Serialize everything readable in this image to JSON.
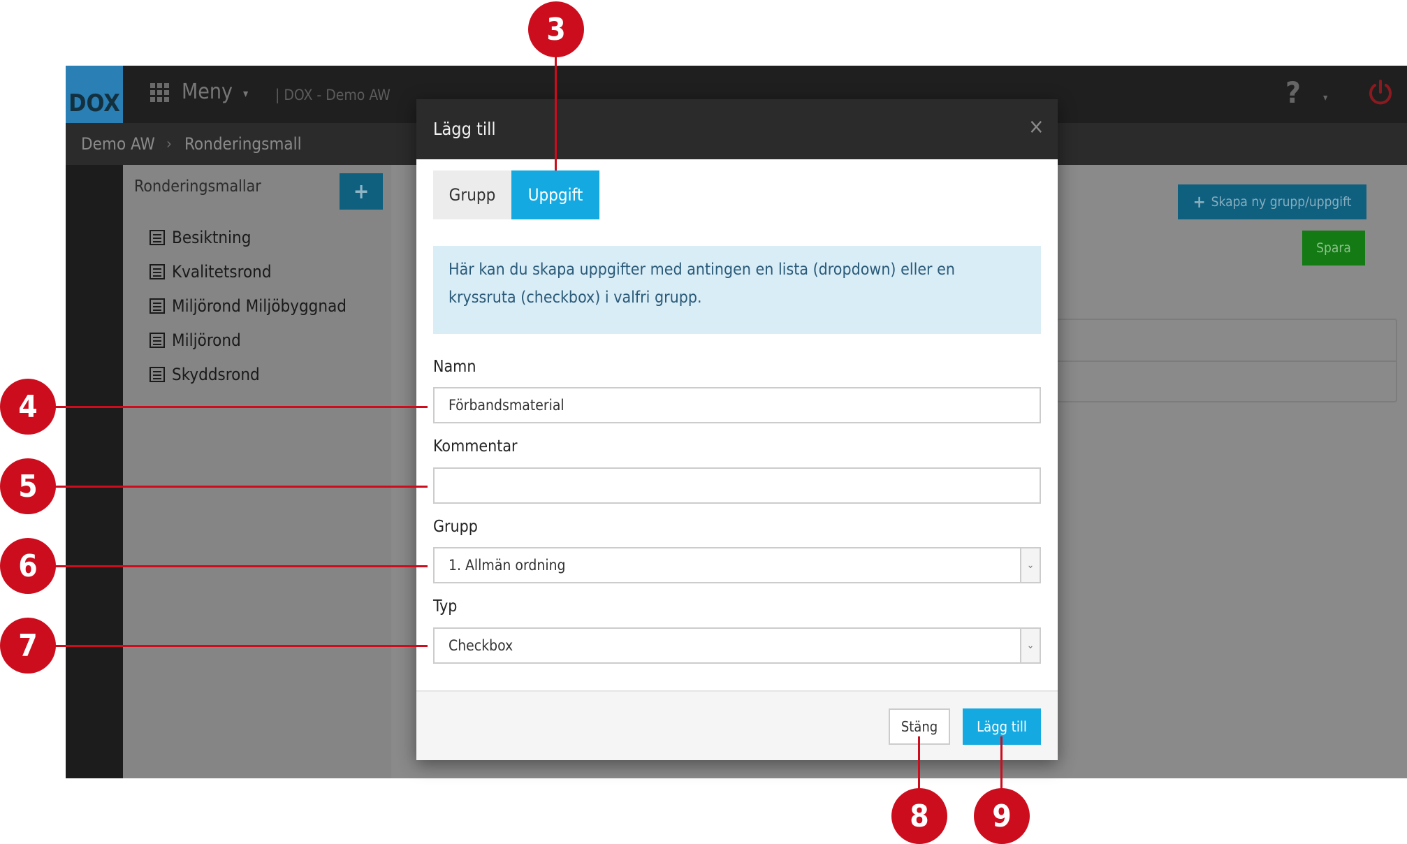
{
  "app": {
    "logo": "DOX",
    "menu_label": "Meny",
    "title": "| DOX - Demo AW",
    "help_label": "?",
    "breadcrumb": {
      "home": "Demo AW",
      "current": "Ronderingsmall"
    }
  },
  "sidebar": {
    "title": "Ronderingsmallar",
    "add_label": "+",
    "items": [
      "Besiktning",
      "Kvalitetsrond",
      "Miljörond Miljöbyggnad",
      "Miljörond",
      "Skyddsrond"
    ]
  },
  "main": {
    "create_button": "Skapa ny grupp/uppgift",
    "save_button": "Spara"
  },
  "modal": {
    "title": "Lägg till",
    "close_symbol": "×",
    "tabs": [
      {
        "label": "Grupp",
        "active": false
      },
      {
        "label": "Uppgift",
        "active": true
      }
    ],
    "info_text": "Här kan du skapa uppgifter med antingen en lista (dropdown) eller en kryssruta (checkbox) i valfri grupp.",
    "fields": {
      "namn": {
        "label": "Namn",
        "value": "Förbandsmaterial"
      },
      "kommentar": {
        "label": "Kommentar",
        "value": ""
      },
      "grupp": {
        "label": "Grupp",
        "selected": "1. Allmän ordning"
      },
      "typ": {
        "label": "Typ",
        "selected": "Checkbox"
      }
    },
    "footer": {
      "close_button": "Stäng",
      "add_button": "Lägg till"
    }
  },
  "callouts": [
    "3",
    "4",
    "5",
    "6",
    "7",
    "8",
    "9"
  ],
  "colors": {
    "accent": "#14a9e0",
    "callout_red": "#cc0d1d",
    "save_green": "#1aa01a",
    "topbar": "#1f1f1f",
    "info_bg": "#d9edf7"
  }
}
